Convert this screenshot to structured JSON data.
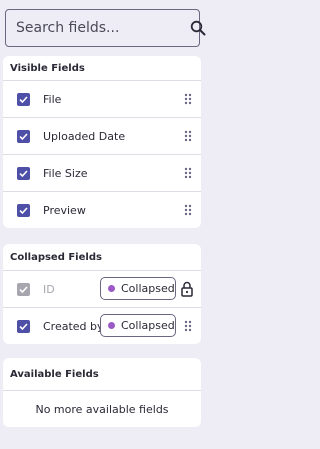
{
  "search": {
    "placeholder": "Search fields..."
  },
  "visible_fields": {
    "title": "Visible Fields",
    "items": [
      {
        "label": "File",
        "checked": true
      },
      {
        "label": "Uploaded Date",
        "checked": true
      },
      {
        "label": "File Size",
        "checked": true
      },
      {
        "label": "Preview",
        "checked": true
      }
    ]
  },
  "collapsed_fields": {
    "title": "Collapsed Fields",
    "items": [
      {
        "label": "ID",
        "checked": true,
        "disabled": true,
        "chip": "Collapsed",
        "locked": true
      },
      {
        "label": "Created by",
        "checked": true,
        "disabled": false,
        "chip": "Collapsed",
        "locked": false
      }
    ]
  },
  "available_fields": {
    "title": "Available Fields",
    "empty_message": "No more available fields"
  },
  "colors": {
    "background": "#eeedf6",
    "accent": "#4e4fa6",
    "chip_dot": "#9b59c6",
    "disabled": "#a7a6ae"
  }
}
